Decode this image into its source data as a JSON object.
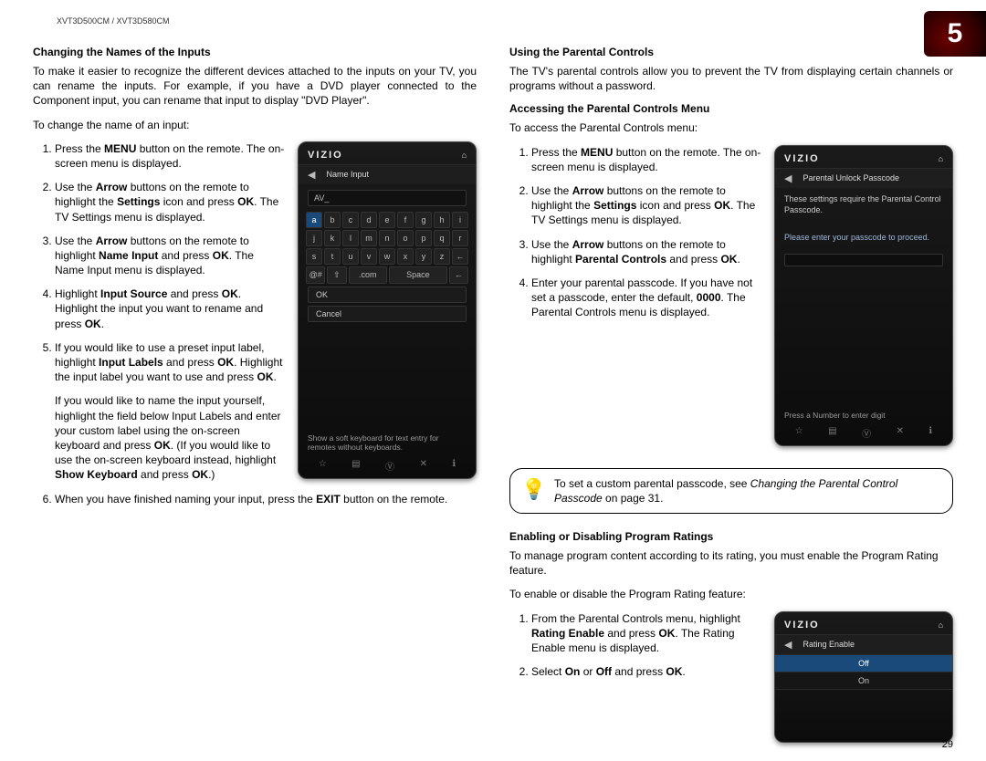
{
  "header": {
    "model": "XVT3D500CM / XVT3D580CM"
  },
  "chapter": {
    "number": "5"
  },
  "left": {
    "h1": "Changing the Names of the Inputs",
    "p1": "To make it easier to recognize the different devices attached to the inputs on your TV, you can rename the inputs. For example, if you have a DVD player connected to the Component input, you can rename that input to display \"DVD Player\".",
    "p2": "To change the name of an input:",
    "steps": {
      "s1a": "Press the ",
      "s1b": "MENU",
      "s1c": " button on the remote. The on-screen menu is displayed.",
      "s2a": "Use the ",
      "s2b": "Arrow",
      "s2c": " buttons on the remote to highlight the ",
      "s2d": "Settings",
      "s2e": " icon and press ",
      "s2f": "OK",
      "s2g": ". The TV Settings menu is displayed.",
      "s3a": "Use the ",
      "s3b": "Arrow",
      "s3c": " buttons on the remote to highlight ",
      "s3d": "Name Input",
      "s3e": " and press ",
      "s3f": "OK",
      "s3g": ". The Name Input menu is displayed.",
      "s4a": "Highlight ",
      "s4b": "Input Source",
      "s4c": " and press ",
      "s4d": "OK",
      "s4e": ". Highlight the input you want to rename and press ",
      "s4f": "OK",
      "s4g": ".",
      "s5a": "If you would like to use a preset input label, highlight ",
      "s5b": "Input Labels",
      "s5c": " and press ",
      "s5d": "OK",
      "s5e": ". Highlight the input label you want to use and press ",
      "s5f": "OK",
      "s5g": ".",
      "indentA": "If you would like to name the input yourself, highlight the field below Input Labels and enter your custom label using the on-screen keyboard and press ",
      "indentB": "OK",
      "indentC": ". (If you would like to use the on-screen keyboard instead, highlight ",
      "indentD": "Show Keyboard",
      "indentE": " and press ",
      "indentF": "OK",
      "indentG": ".)",
      "s6a": "When you have finished naming your input, press the ",
      "s6b": "EXIT",
      "s6c": " button on the remote."
    },
    "fig1": {
      "logo": "VIZIO",
      "title": "Name Input",
      "field": "AV_",
      "row1": [
        "a",
        "b",
        "c",
        "d",
        "e",
        "f",
        "g",
        "h",
        "i"
      ],
      "row2": [
        "j",
        "k",
        "l",
        "m",
        "n",
        "o",
        "p",
        "q",
        "r"
      ],
      "row3": [
        "s",
        "t",
        "u",
        "v",
        "w",
        "x",
        "y",
        "z",
        "←"
      ],
      "row4": [
        "@#",
        "⇧",
        ".com",
        "Space",
        "←"
      ],
      "ok": "OK",
      "cancel": "Cancel",
      "hint": "Show a soft keyboard for text entry for remotes without keyboards.",
      "home_icon": "⌂",
      "back_icon": "◀",
      "bottom": [
        "☆",
        "▤",
        "Ⓥ",
        "✕",
        "ℹ"
      ]
    }
  },
  "right": {
    "h1": "Using the Parental Controls",
    "p1": "The TV's parental controls allow you to prevent the TV from displaying certain channels or programs without a password.",
    "h2": "Accessing the Parental Controls Menu",
    "p2": "To access the Parental Controls menu:",
    "steps": {
      "s1a": "Press the ",
      "s1b": "MENU",
      "s1c": " button on the remote. The on-screen menu is displayed.",
      "s2a": "Use the ",
      "s2b": "Arrow",
      "s2c": " buttons on the remote to highlight the ",
      "s2d": "Settings",
      "s2e": " icon and press ",
      "s2f": "OK",
      "s2g": ". The TV Settings menu is displayed.",
      "s3a": "Use the ",
      "s3b": "Arrow",
      "s3c": " buttons on the remote to highlight ",
      "s3d": "Parental Controls",
      "s3e": " and press ",
      "s3f": "OK",
      "s3g": ".",
      "s4a": "Enter your parental passcode. If you have not set a passcode, enter the default, ",
      "s4b": "0000",
      "s4c": ". The Parental Controls menu is displayed."
    },
    "fig2": {
      "logo": "VIZIO",
      "title": "Parental Unlock Passcode",
      "body1": "These settings require the Parental Control Passcode.",
      "body2": "Please enter your passcode to proceed.",
      "hint": "Press a Number to enter digit",
      "home_icon": "⌂",
      "back_icon": "◀",
      "bottom": [
        "☆",
        "▤",
        "Ⓥ",
        "✕",
        "ℹ"
      ]
    },
    "tip": {
      "a": "To set a custom parental passcode, see ",
      "b": "Changing the Parental Control Passcode",
      "c": " on page 31."
    },
    "h3": "Enabling or Disabling Program Ratings",
    "p3": "To manage program content according to its rating, you must enable the Program Rating feature.",
    "p4": "To enable or disable the Program Rating feature:",
    "steps2": {
      "s1a": "From the Parental Controls menu, highlight ",
      "s1b": "Rating Enable",
      "s1c": " and press ",
      "s1d": "OK",
      "s1e": ". The Rating Enable menu is displayed.",
      "s2a": "Select ",
      "s2b": "On",
      "s2c": " or ",
      "s2d": "Off",
      "s2e": " and press ",
      "s2f": "OK",
      "s2g": "."
    },
    "fig3": {
      "logo": "VIZIO",
      "title": "Rating Enable",
      "opt1": "Off",
      "opt2": "On",
      "home_icon": "⌂",
      "back_icon": "◀"
    }
  },
  "page_number": "29"
}
